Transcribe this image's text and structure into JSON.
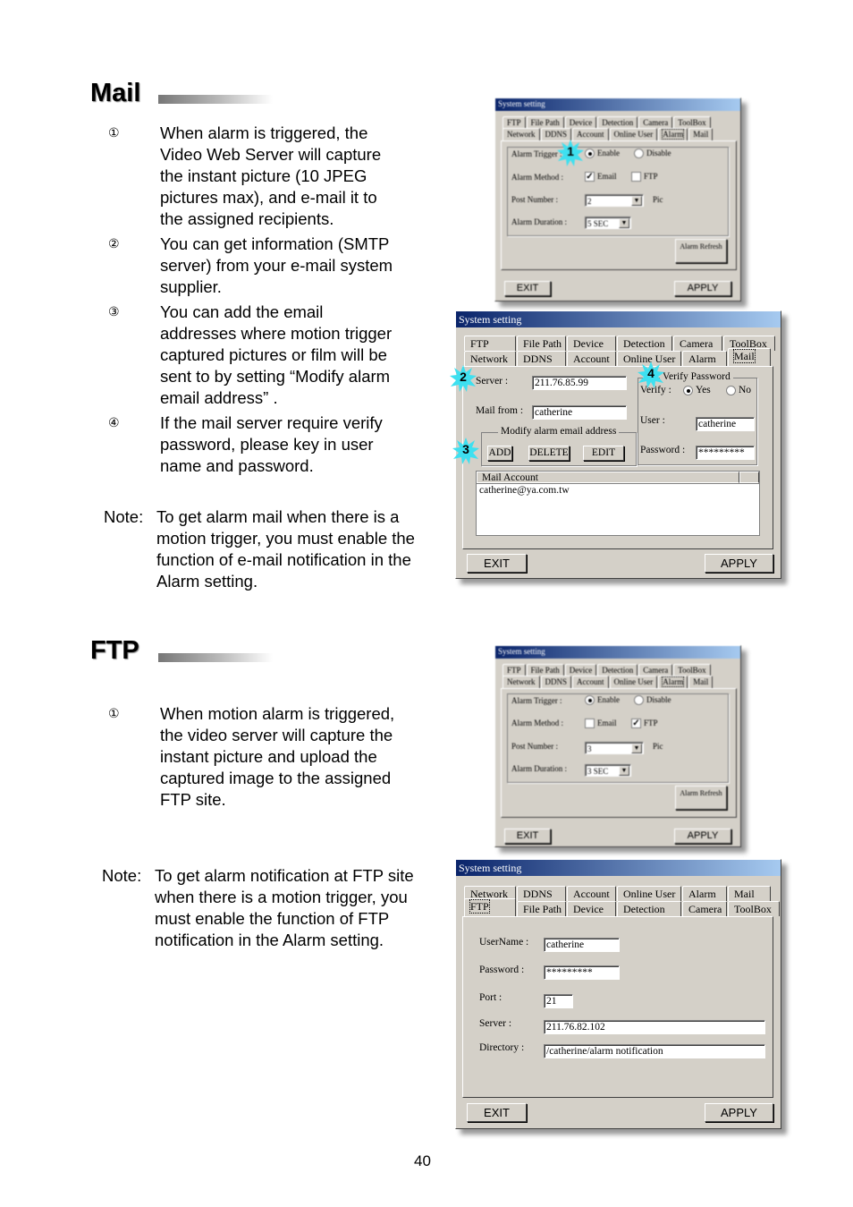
{
  "mail_section": {
    "heading": "Mail",
    "items": [
      {
        "num": "①",
        "text_lines": [
          "When alarm is triggered, the",
          "Video Web Server will capture",
          "the instant picture (10 JPEG",
          "pictures max), and e-mail it to",
          "the assigned recipients."
        ]
      },
      {
        "num": "②",
        "text_lines": [
          "You can get information (SMTP",
          "server) from your e-mail system",
          "supplier."
        ]
      },
      {
        "num": "③",
        "text_lines": [
          "You can add the email",
          "addresses where motion trigger",
          "captured pictures or film will be",
          "sent to by setting “Modify alarm",
          "email address” ."
        ]
      },
      {
        "num": "④",
        "text_lines": [
          "If the mail server require verify",
          "password, please key in user",
          "name and password."
        ]
      }
    ],
    "note_label": "Note:",
    "note_lines": [
      "To get alarm mail when there is a",
      "motion trigger, you must enable the",
      "function of e-mail notification in the",
      "Alarm setting."
    ]
  },
  "ftp_section": {
    "heading": "FTP",
    "items": [
      {
        "num": "①",
        "text_lines": [
          "When motion alarm is triggered,",
          "the video server will capture the",
          "instant picture and upload the",
          "captured image to the assigned",
          "FTP site."
        ]
      }
    ],
    "note_label": "Note:",
    "note_lines": [
      "To get alarm notification at FTP site",
      "when there is a motion trigger, you",
      "must enable the function of FTP",
      "notification in the Alarm setting."
    ]
  },
  "tabs_row_a": [
    "FTP",
    "File Path",
    "Device",
    "Detection",
    "Camera",
    "ToolBox"
  ],
  "tabs_row_b": [
    "Network",
    "DDNS",
    "Account",
    "Online User",
    "Alarm",
    "Mail"
  ],
  "alarm_dialog_mail": {
    "title": "System setting",
    "alarm_trigger_label": "Alarm Trigger :",
    "enable_label": "Enable",
    "disable_label": "Disable",
    "alarm_method_label": "Alarm Method :",
    "email_label": "Email",
    "ftp_label": "FTP",
    "email_checked": "✓",
    "ftp_checked": "",
    "post_number_label": "Post Number :",
    "post_number_value": "2",
    "pic_label": "Pic",
    "alarm_duration_label": "Alarm Duration :",
    "alarm_duration_value": "5   SEC",
    "alarm_refresh_label": "Alarm Refresh",
    "exit_label": "EXIT",
    "apply_label": "APPLY",
    "callout": "1"
  },
  "mail_dialog": {
    "title": "System setting",
    "server_label": "Server :",
    "server_value": "211.76.85.99",
    "mail_from_label": "Mail from :",
    "mail_from_value": "catherine",
    "modify_group_label": "Modify alarm email address",
    "add_label": "ADD",
    "delete_label": "DELETE",
    "edit_label": "EDIT",
    "verify_group_label": "Verify Password",
    "verify_label": "Verify :",
    "yes_label": "Yes",
    "no_label": "No",
    "user_label": "User :",
    "user_value": "catherine",
    "password_label": "Password :",
    "password_value": "*********",
    "list_header": "Mail Account",
    "list_items": [
      "catherine@ya.com.tw"
    ],
    "exit_label": "EXIT",
    "apply_label": "APPLY",
    "callouts": [
      "2",
      "3",
      "4"
    ]
  },
  "alarm_dialog_ftp": {
    "title": "System setting",
    "alarm_trigger_label": "Alarm Trigger :",
    "enable_label": "Enable",
    "disable_label": "Disable",
    "alarm_method_label": "Alarm Method :",
    "email_label": "Email",
    "ftp_label": "FTP",
    "email_checked": "",
    "ftp_checked": "✓",
    "post_number_label": "Post Number :",
    "post_number_value": "3",
    "pic_label": "Pic",
    "alarm_duration_label": "Alarm Duration :",
    "alarm_duration_value": "3   SEC",
    "alarm_refresh_label": "Alarm Refresh",
    "exit_label": "EXIT",
    "apply_label": "APPLY"
  },
  "ftp_dialog": {
    "title": "System setting",
    "username_label": "UserName :",
    "username_value": "catherine",
    "password_label": "Password :",
    "password_value": "*********",
    "port_label": "Port :",
    "port_value": "21",
    "server_label": "Server :",
    "server_value": "211.76.82.102",
    "directory_label": "Directory :",
    "directory_value": "/catherine/alarm notification",
    "exit_label": "EXIT",
    "apply_label": "APPLY"
  },
  "page_number": "40"
}
